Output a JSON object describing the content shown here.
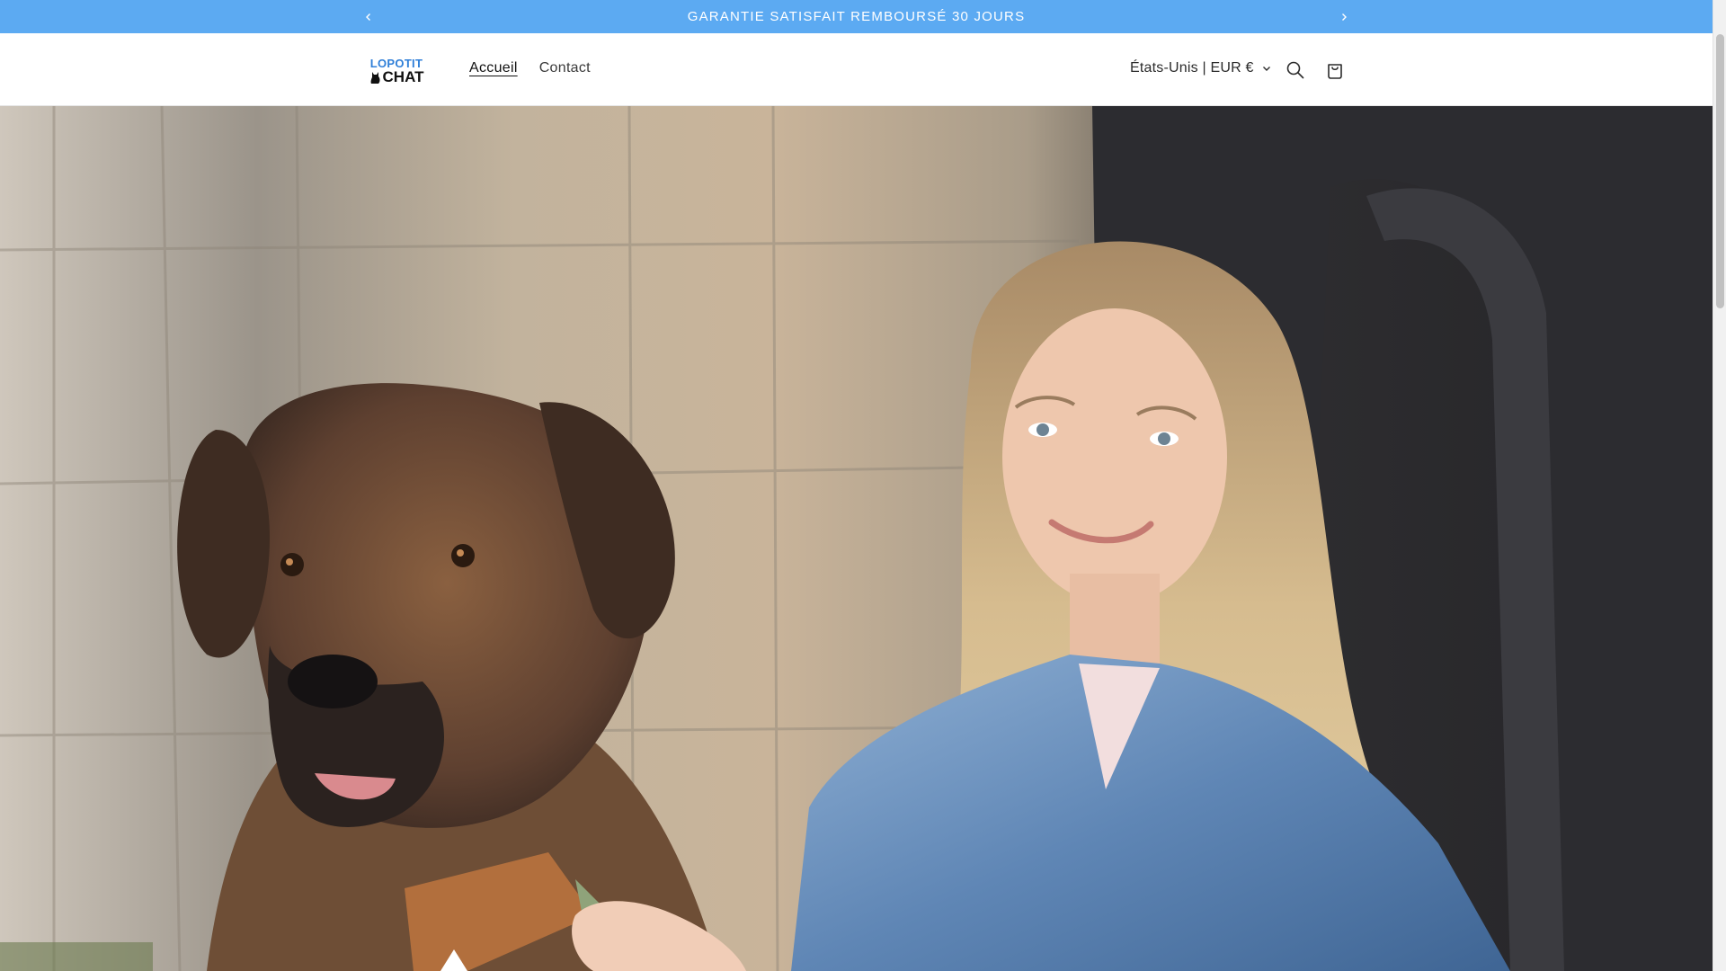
{
  "announcement": {
    "text": "GARANTIE SATISFAIT REMBOURSÉ 30 JOURS",
    "bg_color": "#5caaf2"
  },
  "header": {
    "logo": {
      "line1": "LOPOTIT",
      "line2": "CHAT"
    },
    "nav": [
      {
        "label": "Accueil",
        "active": true
      },
      {
        "label": "Contact",
        "active": false
      }
    ],
    "locale_label": "États-Unis | EUR €",
    "icons": [
      "search-icon",
      "cart-icon"
    ]
  },
  "hero": {
    "image_alt": "dog-and-woman-photo"
  }
}
